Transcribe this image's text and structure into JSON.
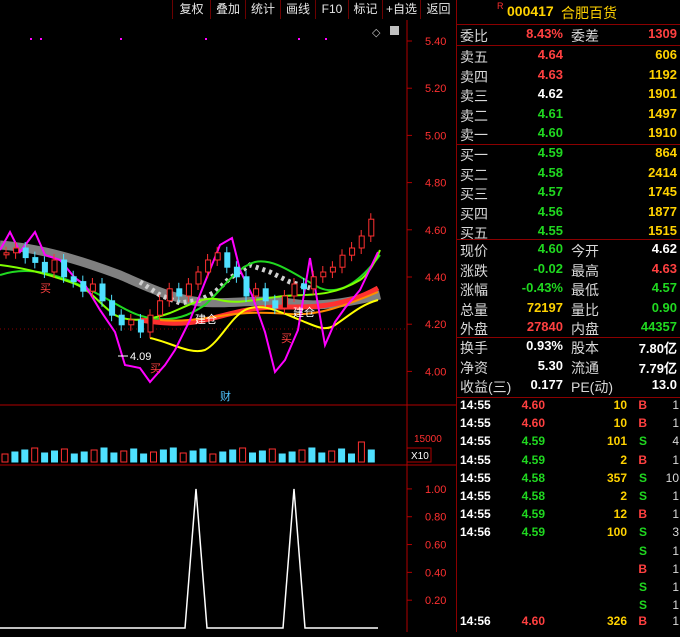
{
  "toolbar": {
    "buttons": [
      "复权",
      "叠加",
      "统计",
      "画线",
      "F10",
      "标记",
      "+自选",
      "返回"
    ]
  },
  "stock": {
    "badge": "R",
    "code": "000417",
    "name": "合肥百货"
  },
  "chart": {
    "price_axis": [
      "5.40",
      "5.20",
      "5.00",
      "4.80",
      "4.60",
      "4.40",
      "4.20",
      "4.00"
    ],
    "annotations": {
      "low_price": "4.09",
      "buy1": "买",
      "buy2": "买",
      "buy3": "买",
      "build1": "建仓",
      "build2": "建仓",
      "finance": "财",
      "diamond": "◇"
    },
    "volume_axis": {
      "label": "15000",
      "unit": "X10"
    },
    "indicator_axis": [
      "1.00",
      "0.80",
      "0.60",
      "0.40",
      "0.20"
    ]
  },
  "chart_data": {
    "type": "line",
    "title": "",
    "xlabel": "",
    "ylabel": "",
    "ylim": [
      3.95,
      5.45
    ],
    "price_path": [
      4.48,
      4.5,
      4.46,
      4.44,
      4.4,
      4.45,
      4.38,
      4.36,
      4.32,
      4.35,
      4.28,
      4.22,
      4.18,
      4.2,
      4.15,
      4.22,
      4.28,
      4.33,
      4.3,
      4.35,
      4.4,
      4.45,
      4.48,
      4.42,
      4.38,
      4.3,
      4.33,
      4.28,
      4.25,
      4.3,
      4.35,
      4.33,
      4.38,
      4.4,
      4.42,
      4.47,
      4.5,
      4.55,
      4.62
    ],
    "indicator_ylim": [
      0,
      1.1
    ],
    "indicator_peaks": [
      1.0,
      1.0
    ]
  },
  "quote": {
    "weibi": {
      "label": "委比",
      "value": "8.43%",
      "label2": "委差",
      "value2": "1309"
    },
    "asks": [
      {
        "label": "卖五",
        "price": "4.64",
        "vol": "606"
      },
      {
        "label": "卖四",
        "price": "4.63",
        "vol": "1192"
      },
      {
        "label": "卖三",
        "price": "4.62",
        "vol": "1901"
      },
      {
        "label": "卖二",
        "price": "4.61",
        "vol": "1497"
      },
      {
        "label": "卖一",
        "price": "4.60",
        "vol": "1910"
      }
    ],
    "bids": [
      {
        "label": "买一",
        "price": "4.59",
        "vol": "864"
      },
      {
        "label": "买二",
        "price": "4.58",
        "vol": "2414"
      },
      {
        "label": "买三",
        "price": "4.57",
        "vol": "1745"
      },
      {
        "label": "买四",
        "price": "4.56",
        "vol": "1877"
      },
      {
        "label": "买五",
        "price": "4.55",
        "vol": "1515"
      }
    ],
    "stats": [
      {
        "l1": "现价",
        "v1": "4.60",
        "l2": "今开",
        "v2": "4.62"
      },
      {
        "l1": "涨跌",
        "v1": "-0.02",
        "l2": "最高",
        "v2": "4.63"
      },
      {
        "l1": "涨幅",
        "v1": "-0.43%",
        "l2": "最低",
        "v2": "4.57"
      },
      {
        "l1": "总量",
        "v1": "72197",
        "l2": "量比",
        "v2": "0.90"
      },
      {
        "l1": "外盘",
        "v1": "27840",
        "l2": "内盘",
        "v2": "44357"
      }
    ],
    "stats2": [
      {
        "l1": "换手",
        "v1": "0.93%",
        "l2": "股本",
        "v2": "7.80亿"
      },
      {
        "l1": "净资",
        "v1": "5.30",
        "l2": "流通",
        "v2": "7.79亿"
      },
      {
        "l1": "收益(三)",
        "v1": "0.177",
        "l2": "PE(动)",
        "v2": "13.0"
      }
    ]
  },
  "ticks": [
    {
      "time": "14:55",
      "price": "4.60",
      "vol": "10",
      "side": "B",
      "n": "1"
    },
    {
      "time": "14:55",
      "price": "4.60",
      "vol": "10",
      "side": "B",
      "n": "1"
    },
    {
      "time": "14:55",
      "price": "4.59",
      "vol": "101",
      "side": "S",
      "n": "4"
    },
    {
      "time": "14:55",
      "price": "4.59",
      "vol": "2",
      "side": "B",
      "n": "1"
    },
    {
      "time": "14:55",
      "price": "4.58",
      "vol": "357",
      "side": "S",
      "n": "10"
    },
    {
      "time": "14:55",
      "price": "4.58",
      "vol": "2",
      "side": "S",
      "n": "1"
    },
    {
      "time": "14:55",
      "price": "4.59",
      "vol": "12",
      "side": "B",
      "n": "1"
    },
    {
      "time": "14:56",
      "price": "4.59",
      "vol": "100",
      "side": "S",
      "n": "3"
    },
    {
      "time": "",
      "price": "",
      "vol": "",
      "side": "S",
      "n": "1"
    },
    {
      "time": "",
      "price": "",
      "vol": "",
      "side": "B",
      "n": "1"
    },
    {
      "time": "",
      "price": "",
      "vol": "",
      "side": "S",
      "n": "1"
    },
    {
      "time": "",
      "price": "",
      "vol": "",
      "side": "S",
      "n": "1"
    },
    {
      "time": "14:56",
      "price": "4.60",
      "vol": "326",
      "side": "B",
      "n": "1"
    }
  ],
  "colors": {
    "up": "#ff4040",
    "down": "#20d820",
    "grid": "#8b0000",
    "axis": "#ff3030"
  }
}
